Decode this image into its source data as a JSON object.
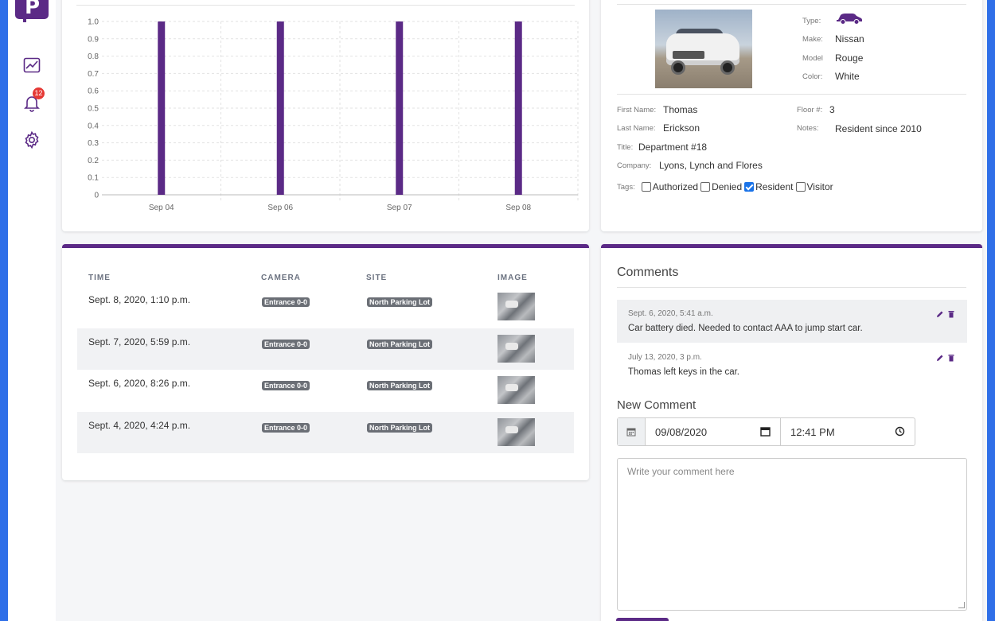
{
  "sidebar": {
    "logo_letter": "P",
    "icons": [
      "chart-line-icon",
      "bell-icon",
      "gear-icon"
    ],
    "notification_count": "12",
    "brand_color": "#5b2a86"
  },
  "chart_data": {
    "type": "bar",
    "categories": [
      "Sep 04",
      "Sep 06",
      "Sep 07",
      "Sep 08"
    ],
    "values": [
      1.0,
      1.0,
      1.0,
      1.0
    ],
    "yticks": [
      "1.0",
      "0.9",
      "0.8",
      "0.7",
      "0.6",
      "0.5",
      "0.4",
      "0.3",
      "0.2",
      "0.1",
      "0"
    ],
    "ylim": [
      0,
      1.0
    ],
    "grid": true,
    "bar_color": "#5b2a86"
  },
  "vehicle": {
    "type_label": "Type:",
    "make_label": "Make:",
    "make": "Nissan",
    "model_label": "Model",
    "model": "Rouge",
    "color_label": "Color:",
    "color": "White",
    "type_icon": "car-icon"
  },
  "person": {
    "first_name_label": "First Name:",
    "first_name": "Thomas",
    "last_name_label": "Last Name:",
    "last_name": "Erickson",
    "title_label": "Title:",
    "title": "Department #18",
    "company_label": "Company:",
    "company": "Lyons, Lynch and Flores",
    "floor_label": "Floor #:",
    "floor": "3",
    "notes_label": "Notes:",
    "notes": "Resident since 2010",
    "tags_label": "Tags:",
    "tags": [
      {
        "label": "Authorized",
        "checked": false
      },
      {
        "label": "Denied",
        "checked": false
      },
      {
        "label": "Resident",
        "checked": true
      },
      {
        "label": "Visitor",
        "checked": false
      }
    ]
  },
  "table": {
    "headers": [
      "TIME",
      "CAMERA",
      "SITE",
      "IMAGE"
    ],
    "rows": [
      {
        "time": "Sept. 8, 2020, 1:10 p.m.",
        "camera": "Entrance 0-0",
        "site": "North Parking Lot"
      },
      {
        "time": "Sept. 7, 2020, 5:59 p.m.",
        "camera": "Entrance 0-0",
        "site": "North Parking Lot"
      },
      {
        "time": "Sept. 6, 2020, 8:26 p.m.",
        "camera": "Entrance 0-0",
        "site": "North Parking Lot"
      },
      {
        "time": "Sept. 4, 2020, 4:24 p.m.",
        "camera": "Entrance 0-0",
        "site": "North Parking Lot"
      }
    ]
  },
  "comments": {
    "title": "Comments",
    "items": [
      {
        "date": "Sept. 6, 2020, 5:41 a.m.",
        "text": "Car battery died. Needed to contact AAA to jump start car."
      },
      {
        "date": "July 13, 2020, 3 p.m.",
        "text": "Thomas left keys in the car."
      }
    ],
    "new_title": "New Comment",
    "date_value": "09/08/2020",
    "time_value": "12:41 PM",
    "placeholder": "Write your comment here"
  }
}
